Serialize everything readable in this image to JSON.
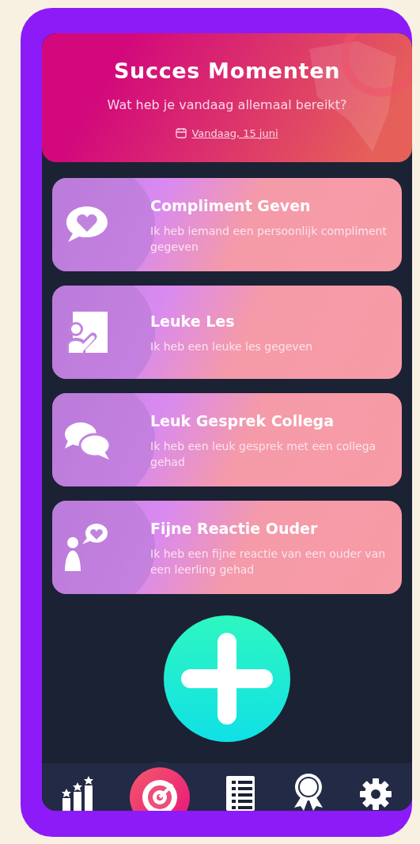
{
  "header": {
    "title": "Succes Momenten",
    "subtitle": "Wat heb je vandaag allemaal bereikt?",
    "date": "Vandaag, 15 juni"
  },
  "moments": [
    {
      "kind": "compliment",
      "title": "Compliment Geven",
      "description": "Ik heb iemand een persoonlijk compliment gegeven"
    },
    {
      "kind": "lesson",
      "title": "Leuke Les",
      "description": "Ik heb een leuke les gegeven"
    },
    {
      "kind": "conversation",
      "title": "Leuk Gesprek Collega",
      "description": "Ik heb een leuk gesprek met een collega gehad"
    },
    {
      "kind": "parent",
      "title": "Fijne Reactie Ouder",
      "description": "Ik heb een fijne reactie van een ouder van een leerling gehad"
    }
  ],
  "nav": [
    {
      "kind": "stats",
      "selected": false
    },
    {
      "kind": "goals",
      "selected": true
    },
    {
      "kind": "list",
      "selected": false
    },
    {
      "kind": "award",
      "selected": false
    },
    {
      "kind": "settings",
      "selected": false
    }
  ]
}
